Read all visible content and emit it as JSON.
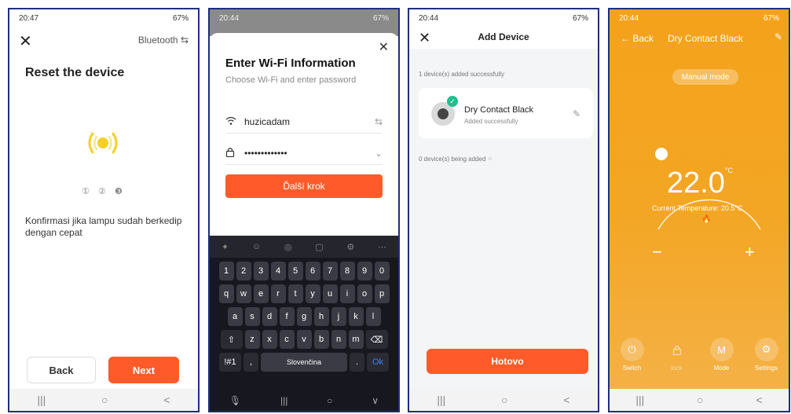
{
  "screen1": {
    "status_time": "20:47",
    "status_right": "67%",
    "bluetooth_label": "Bluetooth",
    "title": "Reset the device",
    "steps": "① ② ❸",
    "instruction": "Konfirmasi jika lampu sudah berkedip dengan cepat",
    "back_label": "Back",
    "next_label": "Next",
    "nav": [
      "|||",
      "○",
      "<"
    ],
    "colors": {
      "accent": "#ff5b2a",
      "lamp": "#f6cf28"
    }
  },
  "screen2": {
    "status_time": "20:44",
    "status_right": "67%",
    "title": "Enter Wi-Fi Information",
    "subtitle": "Choose Wi-Fi and enter password",
    "wifi_name": "huzicadam",
    "password": "•••••••••••••",
    "next_label": "Ďalší krok",
    "keyboard": {
      "numbers": [
        "1",
        "2",
        "3",
        "4",
        "5",
        "6",
        "7",
        "8",
        "9",
        "0"
      ],
      "row1": [
        "q",
        "w",
        "e",
        "r",
        "t",
        "y",
        "u",
        "i",
        "o",
        "p"
      ],
      "row2": [
        "a",
        "s",
        "d",
        "f",
        "g",
        "h",
        "j",
        "k",
        "l"
      ],
      "row3": [
        "z",
        "x",
        "c",
        "v",
        "b",
        "n",
        "m"
      ],
      "symbols_key": "!#1",
      "comma_key": ",",
      "space_label": "Slovenčina",
      "period_key": ".",
      "ok_key": "Ok"
    },
    "nav": [
      "|||",
      "○",
      "∨"
    ]
  },
  "screen3": {
    "status_time": "20:44",
    "status_right": "67%",
    "title": "Add Device",
    "added_text": "1 device(s) added successfully",
    "device_name": "Dry Contact Black",
    "device_status": "Added successfully",
    "adding_text": "0 device(s) being added",
    "done_label": "Hotovo",
    "nav": [
      "|||",
      "○",
      "<"
    ]
  },
  "screen4": {
    "status_time": "20:44",
    "status_right": "67%",
    "back_label": "Back",
    "title": "Dry Contact Black",
    "mode_badge": "Manual mode",
    "temperature": "22.0",
    "temp_unit": "°C",
    "current_temp": "Current Temperature: 20.5°C",
    "minus": "−",
    "plus": "+",
    "controls": [
      {
        "label": "Switch",
        "icon": "power-icon",
        "glyph": "⏻",
        "enabled": true
      },
      {
        "label": "lock",
        "icon": "lock-icon",
        "glyph": "🔒",
        "enabled": false
      },
      {
        "label": "Mode",
        "icon": "mode-icon",
        "glyph": "M",
        "enabled": true
      },
      {
        "label": "Settings",
        "icon": "gear-icon",
        "glyph": "⚙",
        "enabled": true
      }
    ],
    "nav": [
      "|||",
      "○",
      "<"
    ],
    "colors": {
      "background": "#f4a21a"
    }
  }
}
